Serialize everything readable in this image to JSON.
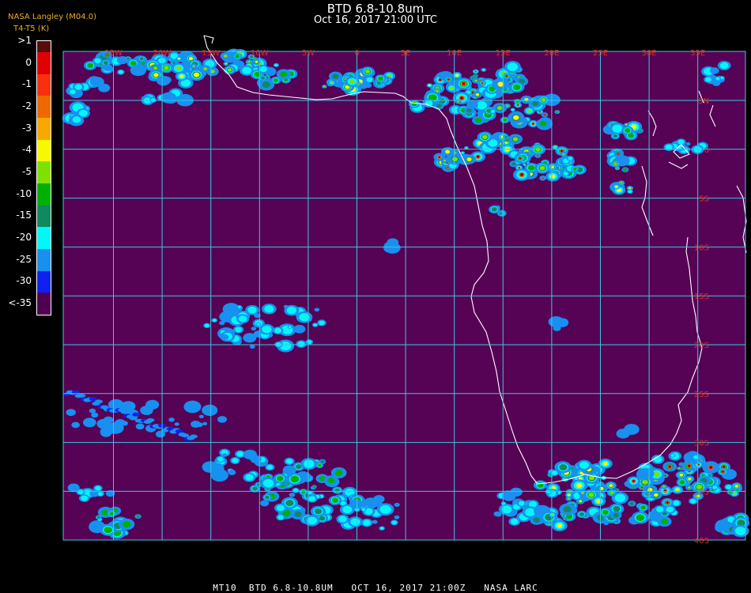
{
  "header": {
    "title": "BTD 6.8-10.8um",
    "subtitle": "Oct 16, 2017 21:00 UTC"
  },
  "credit": {
    "line1": "NASA Langley (M04.0)",
    "line2": "T4-T5 (K)"
  },
  "legend": {
    "entries": [
      {
        "label": ">1",
        "color": "#5a0b0b"
      },
      {
        "label": "0",
        "color": "#e00000"
      },
      {
        "label": "-1",
        "color": "#f83010"
      },
      {
        "label": "-2",
        "color": "#f06800"
      },
      {
        "label": "-3",
        "color": "#f8a800"
      },
      {
        "label": "-4",
        "color": "#f8f800"
      },
      {
        "label": "-5",
        "color": "#80e000"
      },
      {
        "label": "-10",
        "color": "#00b000"
      },
      {
        "label": "-15",
        "color": "#108860"
      },
      {
        "label": "-20",
        "color": "#00f8f8"
      },
      {
        "label": "-25",
        "color": "#1890f0"
      },
      {
        "label": "-30",
        "color": "#1020f0"
      },
      {
        "label": "<-35",
        "color": "#500050"
      }
    ]
  },
  "map": {
    "background_color": "#560356",
    "grid_color": "#38c8e0",
    "label_color": "#e03020",
    "coast_color": "#ffffff",
    "lon_labels": [
      "25W",
      "20W",
      "15W",
      "10W",
      "5W",
      "0",
      "5E",
      "10E",
      "15E",
      "20E",
      "25E",
      "30E",
      "35E"
    ],
    "lat_labels": [
      "5N",
      "0",
      "5S",
      "10S",
      "15S",
      "20S",
      "25S",
      "30S",
      "35S",
      "40S"
    ]
  },
  "footer": {
    "text": "MT10  BTD 6.8-10.8UM   OCT 16, 2017 21:00Z   NASA LARC"
  }
}
